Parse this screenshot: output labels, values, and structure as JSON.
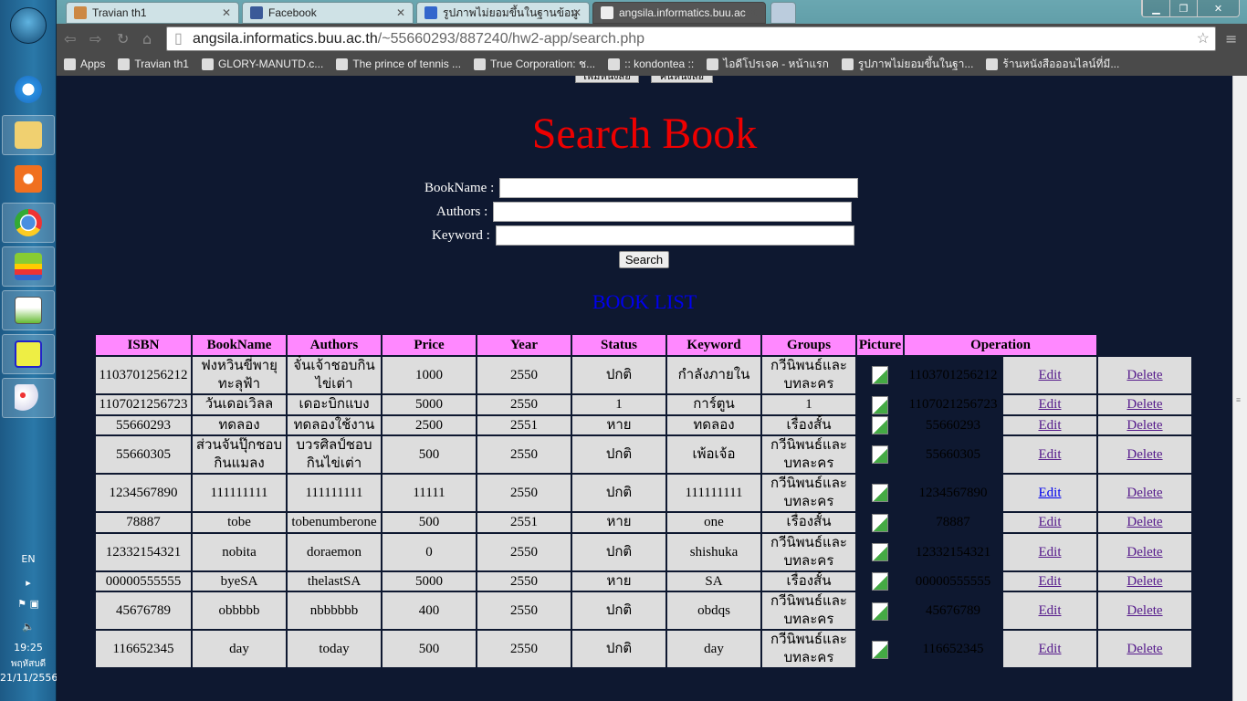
{
  "taskbar": {
    "icons": [
      "windows-start",
      "internet-explorer",
      "file-explorer",
      "media-player",
      "chrome",
      "bluestacks",
      "notepad-plus-plus",
      "app-folder",
      "paint"
    ],
    "tray": {
      "language": "EN",
      "time": "19:25",
      "day": "พฤหัสบดี",
      "date": "21/11/2556"
    }
  },
  "browser": {
    "tabs": [
      {
        "title": "Travian th1"
      },
      {
        "title": "Facebook"
      },
      {
        "title": "รูปภาพไม่ยอมขึ้นในฐานข้อมู"
      },
      {
        "title": "angsila.informatics.buu.ac"
      }
    ],
    "url_host": "angsila.informatics.buu.ac.th",
    "url_path": "/~55660293/887240/hw2-app/search.php",
    "bookmarks": [
      "Apps",
      "Travian th1",
      "GLORY-MANUTD.c...",
      "The prince of tennis ...",
      "True Corporation: ช...",
      ":: kondontea ::",
      "ไอดีโปรเจค - หน้าแรก",
      "รูปภาพไม่ยอมขึ้นในฐา...",
      "ร้านหนังสือออนไลน์ที่มี..."
    ]
  },
  "page": {
    "top_buttons": [
      "เพิ่มหนังสือ",
      "ค้นหนังสือ"
    ],
    "title": "Search Book",
    "form": {
      "bookname_label": "BookName :",
      "authors_label": "Authors :",
      "keyword_label": "Keyword :",
      "bookname_value": "",
      "authors_value": "",
      "keyword_value": "",
      "search_button": "Search"
    },
    "list_title": "BOOK LIST",
    "columns": [
      "ISBN",
      "BookName",
      "Authors",
      "Price",
      "Year",
      "Status",
      "Keyword",
      "Groups",
      "Picture",
      "Operation"
    ],
    "edit_label": "Edit",
    "delete_label": "Delete",
    "rows": [
      [
        "1103701256212",
        "ฟงหวินขี่พายุทะลุฟ้า",
        "จั๋นเจ้าชอบกินไข่เต่า",
        "1000",
        "2550",
        "ปกติ",
        "กำลังภายใน",
        "กวีนิพนธ์และบทละคร"
      ],
      [
        "1107021256723",
        "วันเดอเวิลล",
        "เดอะบิกแบง",
        "5000",
        "2550",
        "1",
        "การ์ตูน",
        "1"
      ],
      [
        "55660293",
        "ทดลอง",
        "ทดลองใช้งาน",
        "2500",
        "2551",
        "หาย",
        "ทดลอง",
        "เรื่องสั้น"
      ],
      [
        "55660305",
        "ส่วนจันปุ๊กชอบกินแมลง",
        "บวรศิลป์ชอบกินไข่เต่า",
        "500",
        "2550",
        "ปกติ",
        "เพ้อเจ้อ",
        "กวีนิพนธ์และบทละคร"
      ],
      [
        "1234567890",
        "111111111",
        "111111111",
        "11111",
        "2550",
        "ปกติ",
        "111111111",
        "กวีนิพนธ์และบทละคร"
      ],
      [
        "78887",
        "tobe",
        "tobenumberone",
        "500",
        "2551",
        "หาย",
        "one",
        "เรื่องสั้น"
      ],
      [
        "12332154321",
        "nobita",
        "doraemon",
        "0",
        "2550",
        "ปกติ",
        "shishuka",
        "กวีนิพนธ์และบทละคร"
      ],
      [
        "00000555555",
        "byeSA",
        "thelastSA",
        "5000",
        "2550",
        "หาย",
        "SA",
        "เรื่องสั้น"
      ],
      [
        "45676789",
        "obbbbb",
        "nbbbbbb",
        "400",
        "2550",
        "ปกติ",
        "obdqs",
        "กวีนิพนธ์และบทละคร"
      ],
      [
        "116652345",
        "day",
        "today",
        "500",
        "2550",
        "ปกติ",
        "day",
        "กวีนิพนธ์และบทละคร"
      ]
    ],
    "unvisited_edit_row": 4
  }
}
